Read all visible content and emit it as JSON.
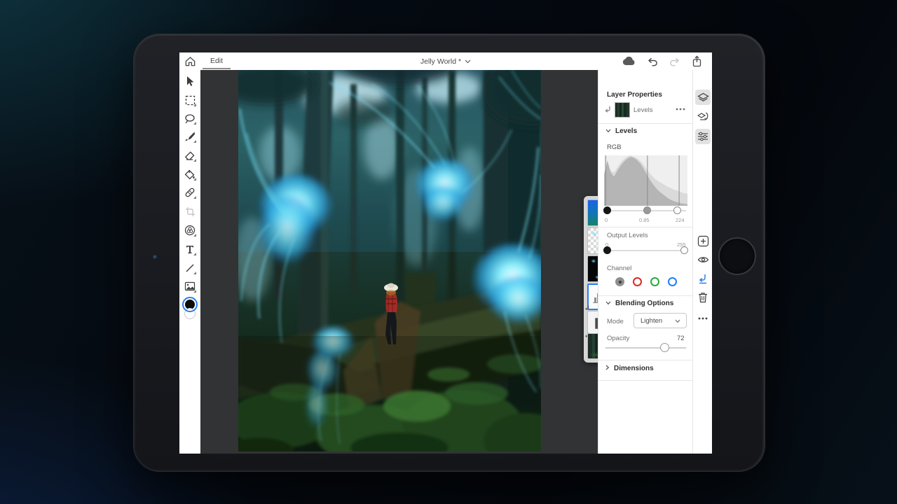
{
  "topbar": {
    "tab_edit": "Edit",
    "title": "Jelly World *",
    "icons": [
      "home-icon",
      "cloud-sync-icon",
      "undo-icon",
      "redo-icon",
      "share-icon",
      "chevron-down-icon"
    ]
  },
  "toolbar": {
    "tools": [
      "move",
      "transform-select",
      "lasso",
      "brush",
      "eraser",
      "fill",
      "healing",
      "crop",
      "adjust",
      "type",
      "line",
      "place-image"
    ],
    "foreground_color": "#0b0b0b",
    "background_color": "#ffffff",
    "accent": "#2b7cf0"
  },
  "layer_strip": {
    "items": [
      {
        "name": "gradient-layer"
      },
      {
        "name": "transparent-jelly-layer"
      },
      {
        "name": "jellyfish-layer"
      },
      {
        "name": "levels-adjustment-layer",
        "selected": true,
        "clipped": true
      },
      {
        "name": "gradient-map-adjustment-layer",
        "clipped": true
      },
      {
        "name": "background-forest-layer"
      }
    ]
  },
  "properties": {
    "panel_title": "Layer Properties",
    "layer_name": "Levels",
    "more_label": "more-options",
    "levels_section": "Levels",
    "rgb_label": "RGB",
    "input_levels": {
      "shadow": "0",
      "midtone": "0.85",
      "highlight": "224"
    },
    "output_levels_label": "Output Levels",
    "output_min": "0",
    "output_max": "255",
    "channel_label": "Channel",
    "channels": [
      {
        "name": "rgb",
        "selected": true,
        "color": "#8f8f8f"
      },
      {
        "name": "red",
        "selected": false,
        "color": "#e0281e"
      },
      {
        "name": "green",
        "selected": false,
        "color": "#27aa3f"
      },
      {
        "name": "blue",
        "selected": false,
        "color": "#1f7ff0"
      }
    ],
    "blending_section": "Blending Options",
    "mode_label": "Mode",
    "mode_value": "Lighten",
    "opacity_label": "Opacity",
    "opacity_value": "72",
    "dimensions_section": "Dimensions"
  },
  "histogram": {
    "main": [
      0.62,
      0.9,
      0.66,
      0.58,
      0.7,
      0.8,
      0.88,
      0.94,
      0.97,
      0.95,
      0.9,
      0.83,
      0.72,
      0.6,
      0.49,
      0.4,
      0.32,
      0.26,
      0.21,
      0.16,
      0.12,
      0.09,
      0.07,
      0.05,
      0.04,
      0.03
    ],
    "light": [
      0.55,
      0.85,
      0.7,
      0.66,
      0.76,
      0.86,
      0.93,
      0.98,
      1.0,
      0.97,
      0.94,
      0.88,
      0.8,
      0.7,
      0.62,
      0.55,
      0.5,
      0.46,
      0.42,
      0.38,
      0.35,
      0.32,
      0.3,
      0.27,
      0.25,
      0.24
    ],
    "right_bar": 0.22,
    "handle_pct": [
      2,
      52,
      90
    ],
    "main_color": "#b5b5b5",
    "light_color": "#dadada"
  },
  "rail": {
    "icons": [
      "layers-icon",
      "layer-reorder-icon",
      "layer-properties-icon",
      "add-layer-icon",
      "visibility-icon",
      "clip-mask-icon",
      "delete-icon",
      "more-icon"
    ],
    "clip_color": "#2b7cf0"
  }
}
